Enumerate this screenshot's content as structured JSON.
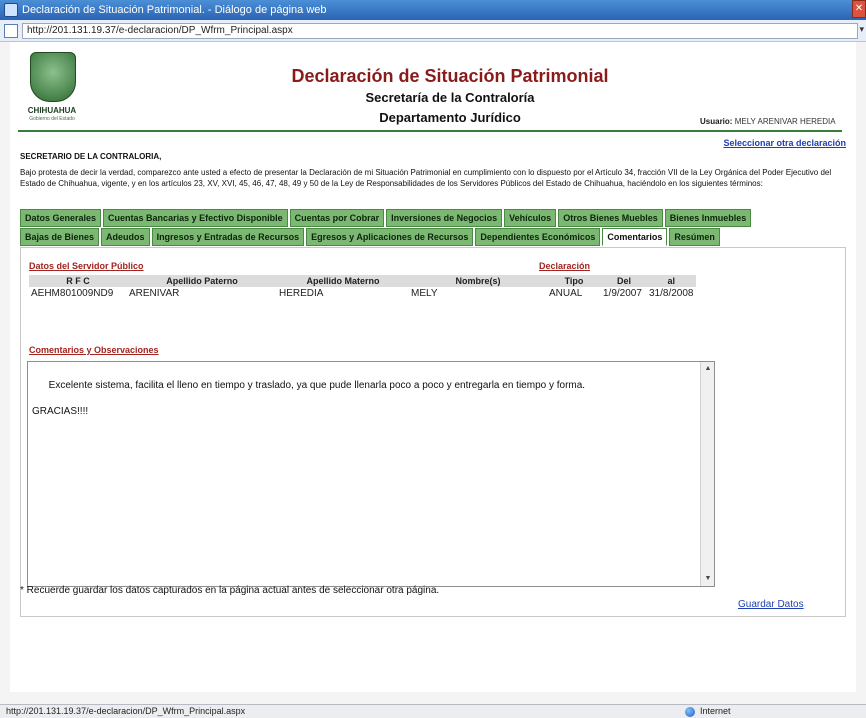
{
  "window": {
    "title": "Declaración de Situación Patrimonial. - Diálogo de página web",
    "close_glyph": "✕",
    "url": "http://201.131.19.37/e-declaracion/DP_Wfrm_Principal.aspx",
    "caret": "▾"
  },
  "logo": {
    "name": "CHIHUAHUA",
    "sub": "Gobierno del Estado"
  },
  "header": {
    "title": "Declaración de Situación Patrimonial",
    "subtitle1": "Secretaría de la Contraloría",
    "subtitle2": "Departamento Jurídico",
    "user_label": "Usuario:",
    "user_name": "MELY ARENIVAR HEREDIA",
    "other_link": "Seleccionar otra declaración"
  },
  "intro": {
    "recipient": "SECRETARIO DE LA CONTRALORIA,",
    "protest": "Bajo protesta de decir la verdad, comparezco ante usted a efecto de presentar la Declaración de mi Situación Patrimonial en cumplimiento con lo dispuesto por el Artículo 34, fracción VII de la Ley Orgánica del Poder Ejecutivo del Estado de Chihuahua, vigente, y en los artículos 23, XV, XVI, 45, 46, 47, 48, 49 y 50 de la Ley de Responsabilidades de los Servidores Públicos del Estado de Chihuahua, haciéndolo en los siguientes términos:"
  },
  "tabs": {
    "row1": [
      "Datos Generales",
      "Cuentas Bancarias y Efectivo Disponible",
      "Cuentas por Cobrar",
      "Inversiones de Negocios",
      "Vehículos",
      "Otros Bienes Muebles",
      "Bienes Inmuebles"
    ],
    "row2": [
      "Bajas de Bienes",
      "Adeudos",
      "Ingresos y Entradas de Recursos",
      "Egresos y Aplicaciones de Recursos",
      "Dependientes Económicos",
      "Comentarios",
      "Resúmen"
    ]
  },
  "servidor": {
    "title": "Datos del Servidor Público",
    "declaracion_title": "Declaración",
    "headers": [
      "R F C",
      "Apellido Paterno",
      "Apellido Materno",
      "Nombre(s)",
      "Tipo",
      "Del",
      "al"
    ],
    "row": [
      "AEHM801009ND9",
      "ARENIVAR",
      "HEREDIA",
      "MELY",
      "ANUAL",
      "1/9/2007",
      "31/8/2008"
    ]
  },
  "comments": {
    "title": "Comentarios y Observaciones",
    "text": "Excelente sistema, facilita el lleno en tiempo y traslado, ya que pude llenarla poco a poco y entregarla en tiempo y forma.\n\nGRACIAS!!!!",
    "up_glyph": "▲",
    "down_glyph": "▼"
  },
  "actions": {
    "save": "Guardar Datos"
  },
  "footnote": "* Recuerde guardar los datos capturados en la página actual antes de seleccionar otra página.",
  "status": {
    "url": "http://201.131.19.37/e-declaracion/DP_Wfrm_Principal.aspx",
    "zone": "Internet"
  },
  "colors": {
    "tab_green": "#7bb872",
    "section_red": "#a3231f",
    "title_red": "#8a1b1b",
    "link_blue": "#1f3fb3"
  }
}
